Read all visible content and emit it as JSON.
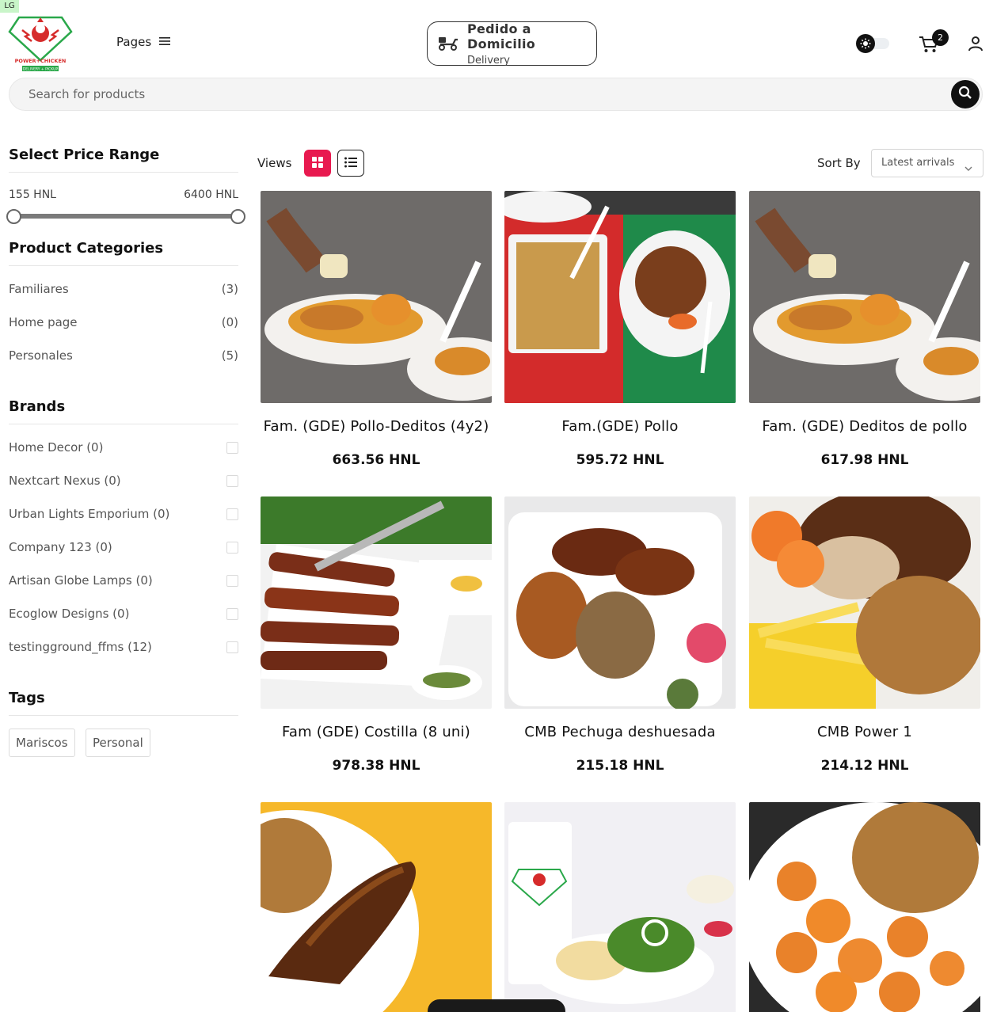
{
  "badge": "LG",
  "header": {
    "pages_label": "Pages",
    "delivery_title": "Pedido a Domicilio",
    "delivery_subtitle": "Delivery",
    "cart_count": "2"
  },
  "logo": {
    "brand_text": "POWER+CHICKEN",
    "tagline": "DELIVERY + PICKUP",
    "colors": {
      "red": "#d62b2b",
      "green": "#2aa84a"
    }
  },
  "search": {
    "placeholder": "Search for products"
  },
  "sidebar": {
    "price": {
      "title": "Select Price Range",
      "min": "155 HNL",
      "max": "6400 HNL"
    },
    "categories": {
      "title": "Product Categories",
      "items": [
        {
          "label": "Familiares",
          "count": "(3)"
        },
        {
          "label": "Home page",
          "count": "(0)"
        },
        {
          "label": "Personales",
          "count": "(5)"
        }
      ]
    },
    "brands": {
      "title": "Brands",
      "items": [
        {
          "label": "Home Decor (0)"
        },
        {
          "label": "Nextcart Nexus (0)"
        },
        {
          "label": "Urban Lights Emporium (0)"
        },
        {
          "label": "Company 123 (0)"
        },
        {
          "label": "Artisan Globe Lamps (0)"
        },
        {
          "label": "Ecoglow Designs (0)"
        },
        {
          "label": "testingground_ffms (12)"
        }
      ]
    },
    "tags": {
      "title": "Tags",
      "items": [
        "Mariscos",
        "Personal"
      ]
    }
  },
  "toolbar": {
    "views_label": "Views",
    "sort_label": "Sort By",
    "sort_value": "Latest arrivals",
    "accent": "#e8194f"
  },
  "products": [
    {
      "name": "Fam. (GDE) Pollo-Deditos (4y2)",
      "price": "663.56 HNL"
    },
    {
      "name": "Fam.(GDE) Pollo",
      "price": "595.72 HNL"
    },
    {
      "name": "Fam. (GDE) Deditos de pollo",
      "price": "617.98 HNL"
    },
    {
      "name": "Fam (GDE) Costilla (8 uni)",
      "price": "978.38 HNL"
    },
    {
      "name": "CMB Pechuga deshuesada",
      "price": "215.18 HNL"
    },
    {
      "name": "CMB Power 1",
      "price": "214.12 HNL"
    },
    {
      "name": "",
      "price": ""
    },
    {
      "name": "",
      "price": ""
    },
    {
      "name": "",
      "price": ""
    }
  ]
}
